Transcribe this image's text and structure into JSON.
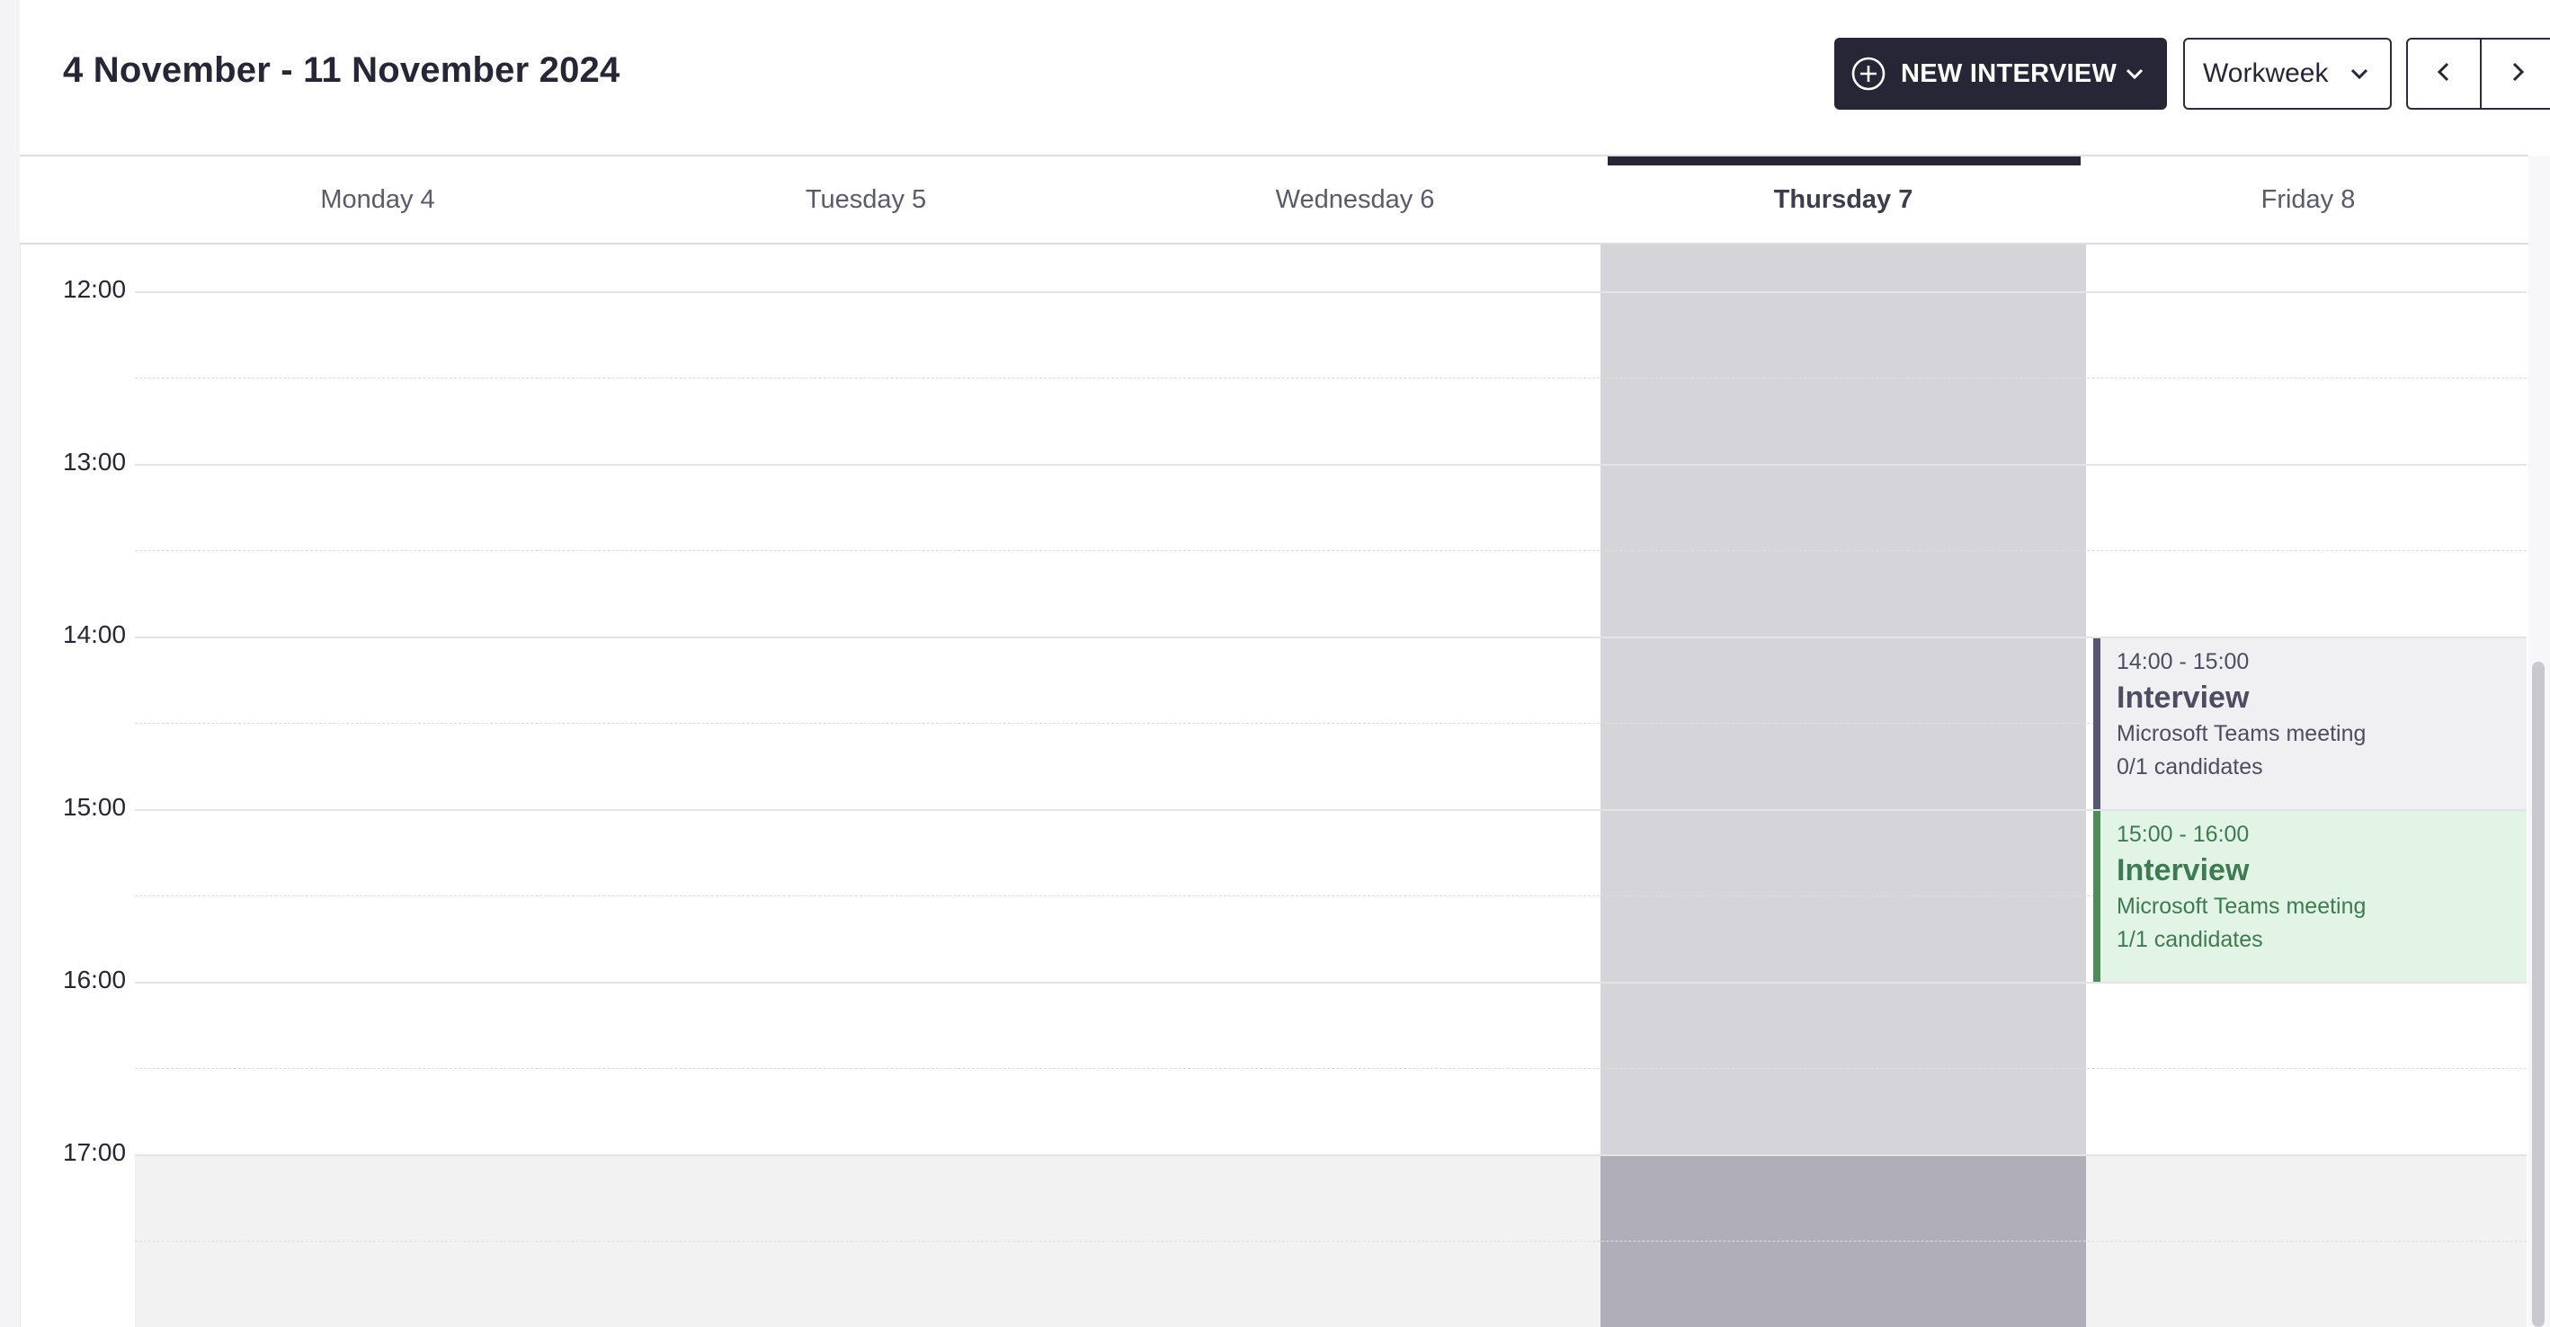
{
  "header": {
    "range_title": "4 November - 11 November 2024",
    "new_interview_label": "NEW INTERVIEW",
    "view_select_value": "Workweek",
    "icons": {
      "new": "plus-circle-icon",
      "dropdown": "chevron-down-icon",
      "prev": "chevron-left-icon",
      "next": "chevron-right-icon"
    }
  },
  "days": [
    {
      "label": "Monday 4",
      "today": false
    },
    {
      "label": "Tuesday 5",
      "today": false
    },
    {
      "label": "Wednesday 6",
      "today": false
    },
    {
      "label": "Thursday 7",
      "today": true
    },
    {
      "label": "Friday 8",
      "today": false
    }
  ],
  "times": [
    "12:00",
    "13:00",
    "14:00",
    "15:00",
    "16:00",
    "17:00"
  ],
  "events": [
    {
      "day": "Friday 8",
      "time": "14:00 - 15:00",
      "title": "Interview",
      "location": "Microsoft Teams meeting",
      "candidates": "0/1 candidates",
      "status_color": "#575772"
    },
    {
      "day": "Friday 8",
      "time": "15:00 - 16:00",
      "title": "Interview",
      "location": "Microsoft Teams meeting",
      "candidates": "1/1 candidates",
      "status_color": "#4e8c5d"
    }
  ],
  "colors": {
    "primary": "#262637",
    "today_column": "#d4d4d9",
    "after_hours": "#f2f2f3",
    "event_pending_bg": "#f0f0f3",
    "event_confirmed_bg": "#e2f4e6"
  }
}
